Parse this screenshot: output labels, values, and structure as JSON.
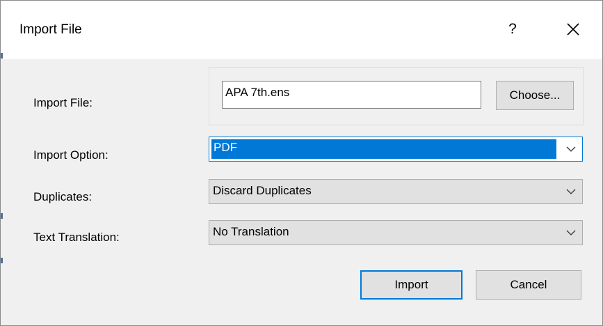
{
  "window": {
    "title": "Import File",
    "help_label": "?"
  },
  "form": {
    "import_file": {
      "label": "Import File:",
      "value": "APA 7th.ens",
      "choose_label": "Choose..."
    },
    "import_option": {
      "label": "Import Option:",
      "selected": "PDF"
    },
    "duplicates": {
      "label": "Duplicates:",
      "selected": "Discard Duplicates"
    },
    "text_translation": {
      "label": "Text Translation:",
      "selected": "No Translation"
    }
  },
  "buttons": {
    "import_label": "Import",
    "cancel_label": "Cancel"
  },
  "colors": {
    "accent": "#0078d7",
    "dialog_bg": "#f0f0f0",
    "button_bg": "#e1e1e1"
  },
  "icons": {
    "close": "close-icon",
    "help": "help-icon",
    "dropdown": "chevron-down-icon"
  }
}
